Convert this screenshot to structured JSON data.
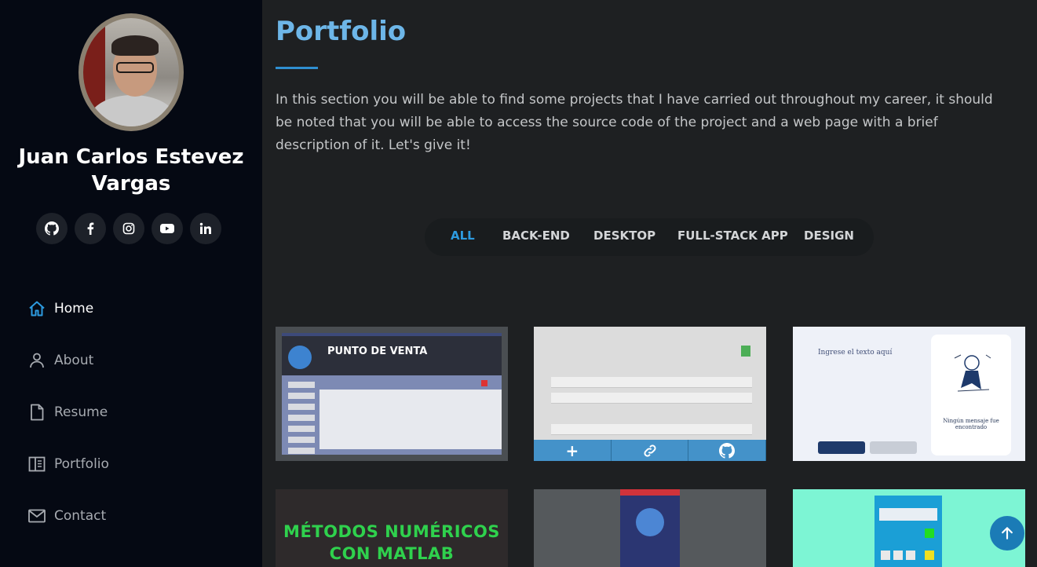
{
  "profile": {
    "name": "Juan Carlos Estevez Vargas"
  },
  "socials": [
    {
      "name": "github-icon",
      "glyph": "⌥"
    },
    {
      "name": "facebook-icon",
      "glyph": "f"
    },
    {
      "name": "instagram-icon",
      "glyph": "◎"
    },
    {
      "name": "youtube-icon",
      "glyph": "▶"
    },
    {
      "name": "linkedin-icon",
      "glyph": "in"
    }
  ],
  "nav": {
    "items": [
      {
        "label": "Home",
        "icon": "home-icon",
        "active": true
      },
      {
        "label": "About",
        "icon": "person-icon",
        "active": false
      },
      {
        "label": "Resume",
        "icon": "file-icon",
        "active": false
      },
      {
        "label": "Portfolio",
        "icon": "book-icon",
        "active": false
      },
      {
        "label": "Contact",
        "icon": "envelope-icon",
        "active": false
      }
    ]
  },
  "section": {
    "title": "Portfolio",
    "intro": "In this section you will be able to find some projects that I have carried out throughout my career, it should be noted that you will be able to access the source code of the project and a web page with a brief description of it. Let's give it!"
  },
  "filters": {
    "items": [
      "ALL",
      "BACK-END",
      "DESKTOP",
      "FULL-STACK APP",
      "DESIGN"
    ],
    "active": "ALL"
  },
  "portfolio": {
    "punto_de_venta_title": "PUNTO DE VENTA",
    "messages_input_label": "Ingrese el texto aquí",
    "messages_empty_caption": "Ningún mensaje fue encontrado",
    "matlab_title_line1": "MÉTODOS NUMÉRICOS",
    "matlab_title_line2": "CON MATLAB",
    "list_actions": [
      "+",
      "🔗",
      "⌥"
    ]
  },
  "colors": {
    "accent": "#2d9be0",
    "title": "#6db6e8",
    "sidebar_bg": "#050913",
    "main_bg": "#1e2022"
  },
  "back_to_top_icon": "arrow-up-icon"
}
